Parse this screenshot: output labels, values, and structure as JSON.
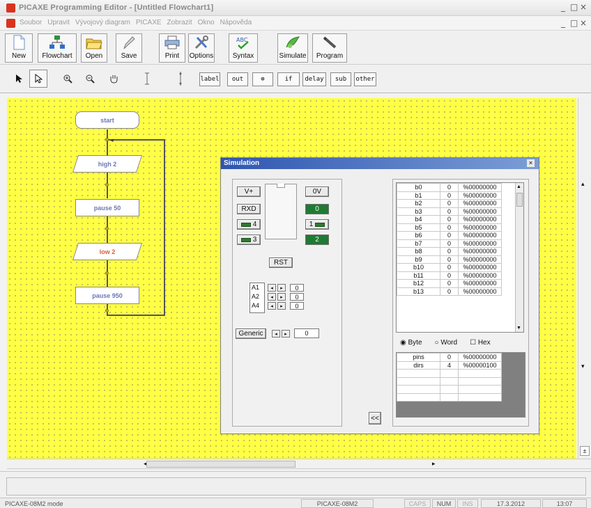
{
  "window": {
    "title": "PICAXE Programming Editor - [Untitled Flowchart1]",
    "controls": [
      "_",
      "□",
      "×"
    ],
    "inner_controls": [
      "_",
      "□",
      "×"
    ]
  },
  "menu": [
    "Soubor",
    "Upravit",
    "Vývojový diagram",
    "PICAXE",
    "Zobrazit",
    "Okno",
    "Nápověda"
  ],
  "toolbar": {
    "buttons": [
      {
        "label": "New",
        "icon": "new-file-icon"
      },
      {
        "label": "Flowchart",
        "icon": "flowchart-icon"
      },
      {
        "label": "Open",
        "icon": "open-folder-icon"
      },
      {
        "label": "Save",
        "icon": "save-pen-icon"
      },
      {
        "label": "Print",
        "icon": "printer-icon"
      },
      {
        "label": "Options",
        "icon": "tools-icon"
      },
      {
        "label": "Syntax",
        "icon": "syntax-check-icon"
      },
      {
        "label": "Simulate",
        "icon": "simulate-icon"
      },
      {
        "label": "Program",
        "icon": "program-cable-icon"
      }
    ]
  },
  "flowtools": {
    "select_icons": [
      "arrow-icon",
      "select-icon",
      "zoom-in-icon",
      "zoom-out-icon",
      "pan-hand-icon",
      "line-icon",
      "connector-icon"
    ],
    "label": "label",
    "shapes": [
      "out",
      "⊕",
      "if",
      "delay",
      "sub",
      "other"
    ]
  },
  "flowchart": {
    "blocks": [
      "start",
      "high 2",
      "pause 50",
      "low 2",
      "pause 950"
    ]
  },
  "simulation": {
    "title": "Simulation",
    "close": "×",
    "chip": {
      "vplus": "V+",
      "zerov": "0V",
      "rxd": "RXD",
      "pin4": "4",
      "pin3": "3",
      "pin0": "0",
      "pin1": "1",
      "pin2": "2",
      "rst": "RST"
    },
    "analog": [
      {
        "name": "A1",
        "value": "0"
      },
      {
        "name": "A2",
        "value": "0"
      },
      {
        "name": "A4",
        "value": "0"
      }
    ],
    "generic": {
      "label": "Generic",
      "value": "0"
    },
    "collapse": "<<",
    "registers": [
      {
        "name": "b0",
        "value": "0",
        "binary": "%00000000"
      },
      {
        "name": "b1",
        "value": "0",
        "binary": "%00000000"
      },
      {
        "name": "b2",
        "value": "0",
        "binary": "%00000000"
      },
      {
        "name": "b3",
        "value": "0",
        "binary": "%00000000"
      },
      {
        "name": "b4",
        "value": "0",
        "binary": "%00000000"
      },
      {
        "name": "b5",
        "value": "0",
        "binary": "%00000000"
      },
      {
        "name": "b6",
        "value": "0",
        "binary": "%00000000"
      },
      {
        "name": "b7",
        "value": "0",
        "binary": "%00000000"
      },
      {
        "name": "b8",
        "value": "0",
        "binary": "%00000000"
      },
      {
        "name": "b9",
        "value": "0",
        "binary": "%00000000"
      },
      {
        "name": "b10",
        "value": "0",
        "binary": "%00000000"
      },
      {
        "name": "b11",
        "value": "0",
        "binary": "%00000000"
      },
      {
        "name": "b12",
        "value": "0",
        "binary": "%00000000"
      },
      {
        "name": "b13",
        "value": "0",
        "binary": "%00000000"
      }
    ],
    "format": {
      "byte": "Byte",
      "word": "Word",
      "hex": "Hex",
      "selected": "Byte"
    },
    "ports": [
      {
        "name": "pins",
        "value": "0",
        "binary": "%00000000"
      },
      {
        "name": "dirs",
        "value": "4",
        "binary": "%00000100"
      }
    ]
  },
  "statusbar": {
    "mode": "PICAXE-08M2 mode",
    "chip": "PICAXE-08M2",
    "caps": "CAPS",
    "num": "NUM",
    "ins": "INS",
    "date": "17.3.2012",
    "time": "13:07"
  },
  "hscroll": {
    "left": "◂",
    "right": "▸"
  },
  "vscroll": {
    "up": "▴",
    "down": "▾",
    "corner": "±"
  }
}
